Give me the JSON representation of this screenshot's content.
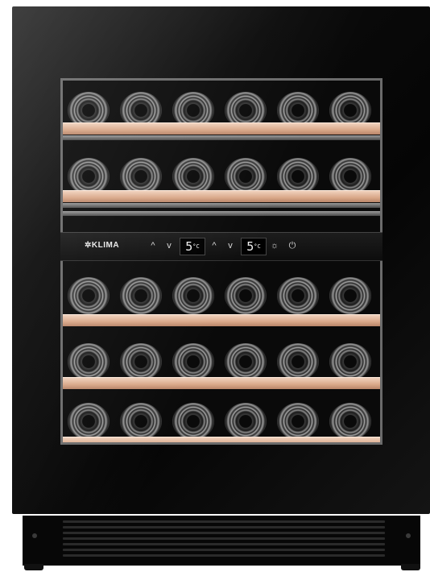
{
  "brand": {
    "name": "✲KLIMA"
  },
  "controls": {
    "zone1": {
      "up_icon": "chevron-up-icon",
      "down_icon": "chevron-down-icon",
      "up_glyph": "^",
      "down_glyph": "v",
      "temperature": "5",
      "unit": "°C"
    },
    "zone2": {
      "up_icon": "chevron-up-icon",
      "down_icon": "chevron-down-icon",
      "up_glyph": "^",
      "down_glyph": "v",
      "temperature": "5",
      "unit": "°C"
    },
    "light_glyph": "☼",
    "power_glyph": "⏻"
  },
  "bottle_rows": 5,
  "bottles_per_row": 6,
  "colors": {
    "cabinet": "#0b0b0b",
    "shelf_wood": "#d9a889",
    "frame": "#6b6b6b"
  }
}
